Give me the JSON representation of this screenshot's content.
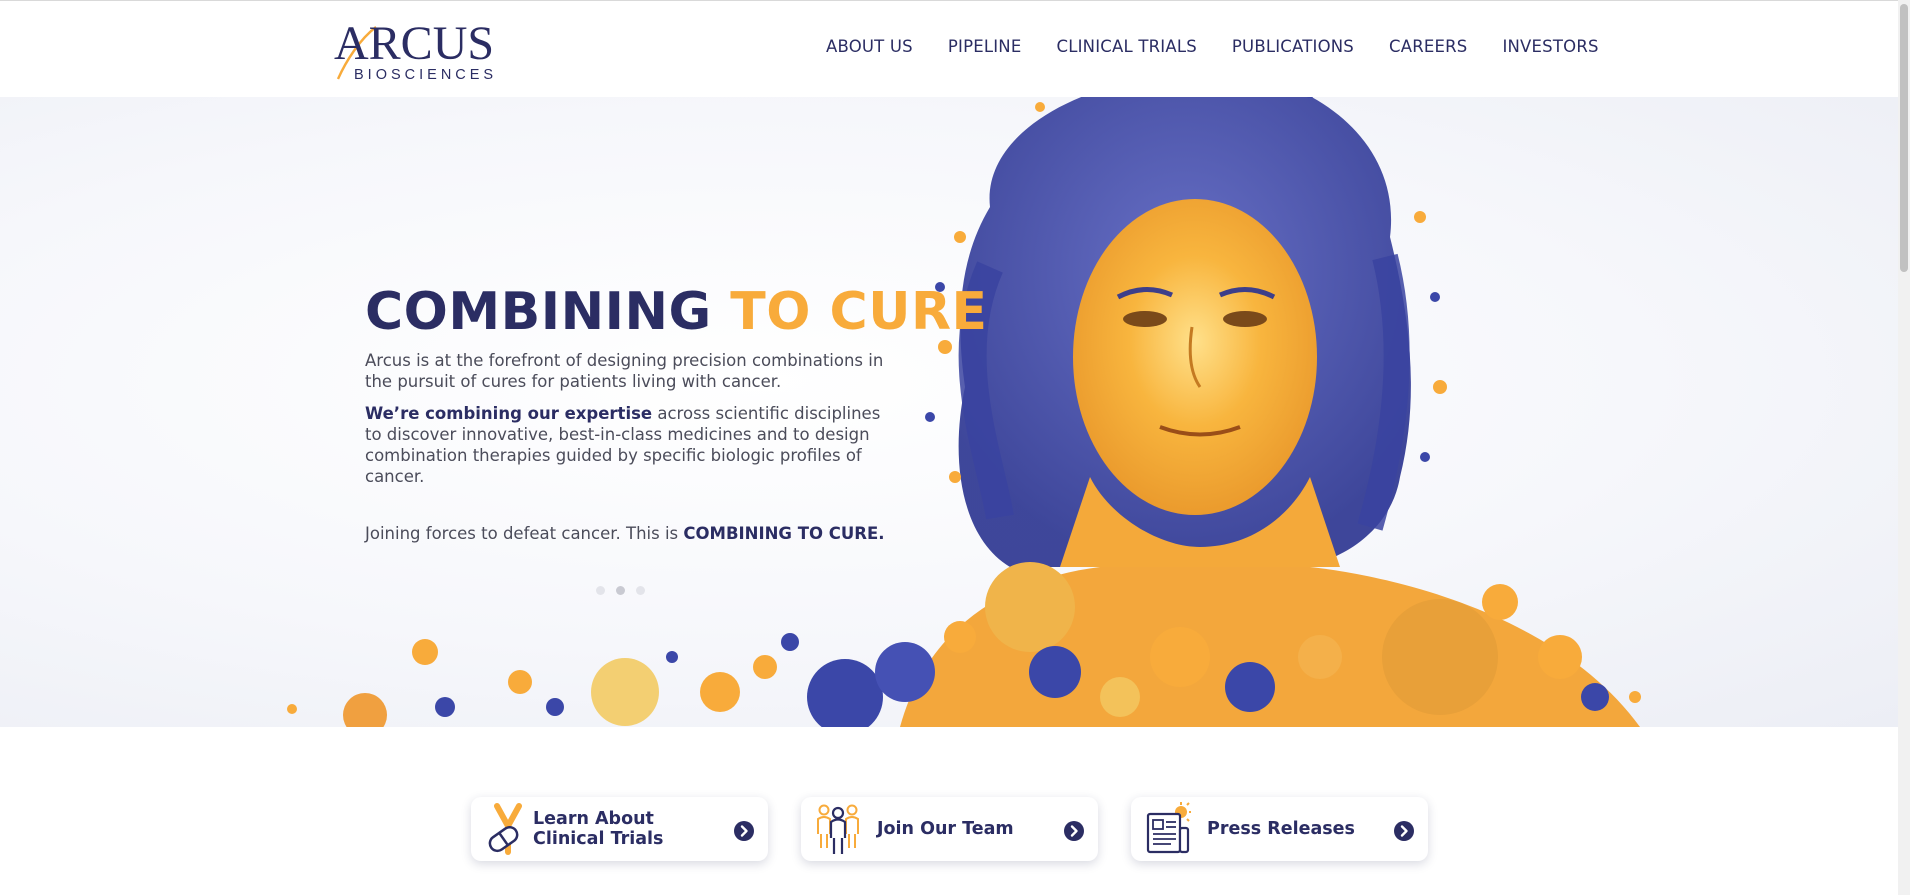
{
  "brand": {
    "name": "ARCUS",
    "sub": "BIOSCIENCES"
  },
  "nav": {
    "items": [
      "ABOUT US",
      "PIPELINE",
      "CLINICAL TRIALS",
      "PUBLICATIONS",
      "CAREERS",
      "INVESTORS"
    ]
  },
  "hero": {
    "headline_dark": "COMBINING",
    "headline_orange": "TO CURE",
    "para1": "Arcus is at the forefront of designing precision combinations in the pursuit of cures for patients living with cancer.",
    "para2_bold": "We’re combining our expertise",
    "para2_rest": " across scientific disciplines to discover innovative, best-in-class medicines and to design combination therapies guided by specific biologic profiles of cancer.",
    "para3_plain": "Joining forces to defeat cancer. This is ",
    "para3_bold": "COMBINING TO CURE.",
    "slides": 3,
    "active_slide": 2
  },
  "cards": [
    {
      "label_line1": "Learn About",
      "label_line2": "Clinical Trials",
      "icon": "clinical-trials-icon"
    },
    {
      "label_line1": "Join Our Team",
      "label_line2": "",
      "icon": "team-icon"
    },
    {
      "label_line1": "Press Releases",
      "label_line2": "",
      "icon": "press-releases-icon"
    }
  ],
  "colors": {
    "navy": "#2b2d63",
    "orange": "#f8ab3b",
    "blue": "#3b47a8",
    "text_gray": "#4b4c5a"
  }
}
